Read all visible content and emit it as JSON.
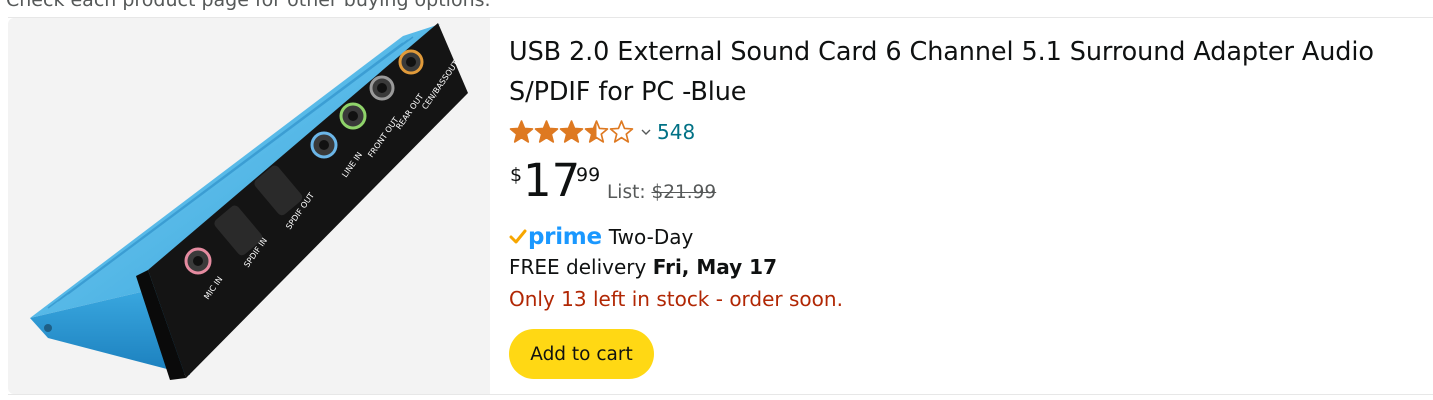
{
  "top_note": "Check each product page for other buying options.",
  "product": {
    "image_alt": "USB sound card blue aluminum box",
    "port_labels": [
      "MIC IN",
      "SPDIF IN",
      "SPDIF OUT",
      "LINE IN",
      "FRONT OUT",
      "REAR OUT",
      "CEN/BASSOUT"
    ],
    "title": "USB 2.0 External Sound Card 6 Channel 5.1 Surround Adapter Audio S/PDIF for PC -Blue",
    "rating_value": 3.5,
    "rating_max": 5,
    "rating_count": "548",
    "price": {
      "currency": "$",
      "whole": "17",
      "fraction": "99",
      "list_label": "List:",
      "list_price": "$21.99"
    },
    "prime": {
      "logo_word": "prime",
      "label": "Two-Day"
    },
    "delivery": {
      "prefix": "FREE delivery",
      "date": "Fri, May 17"
    },
    "stock_message": "Only 13 left in stock - order soon.",
    "add_to_cart_label": "Add to cart"
  },
  "colors": {
    "star": "#de7921",
    "link": "#007185",
    "price_red": "#b12704",
    "prime_blue": "#1a98ff",
    "button_yellow": "#ffd814"
  },
  "icons": [
    "star-icon",
    "chevron-down-icon",
    "prime-check-icon"
  ]
}
